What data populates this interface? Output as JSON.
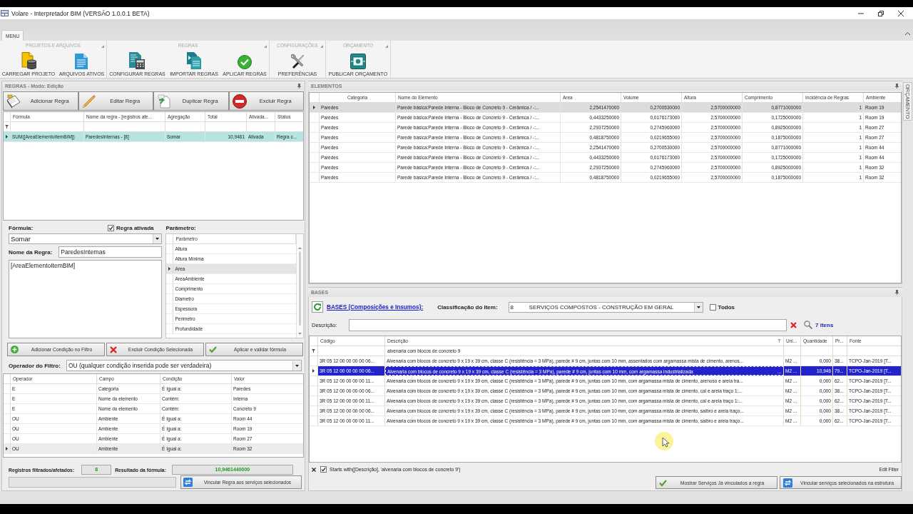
{
  "window": {
    "title": "Volare - Interpretador BIM (VERSÃO 1.0.0.1 BETA)"
  },
  "ribbon": {
    "tabs": [
      {
        "label": "MENU",
        "selected": true
      }
    ],
    "groups": [
      {
        "title": "PROJETOS E ARQUIVOS",
        "buttons": [
          {
            "label": "CARREGAR PROJETO",
            "kind": "database"
          },
          {
            "label": "ARQUIVOS ATIVOS",
            "kind": "document"
          }
        ]
      },
      {
        "title": "REGRAS",
        "buttons": [
          {
            "label": "CONFIGURAR REGRAS",
            "kind": "calculator"
          },
          {
            "label": "IMPORTAR REGRAS",
            "kind": "documents"
          },
          {
            "label": "APLICAR REGRAS",
            "kind": "check"
          }
        ]
      },
      {
        "title": "CONFIGURAÇÕES",
        "buttons": [
          {
            "label": "PREFERÊNCIAS",
            "kind": "tools"
          }
        ]
      },
      {
        "title": "ORÇAMENTO",
        "buttons": [
          {
            "label": "PUBLICAR ORÇAMENTO",
            "kind": "money"
          }
        ]
      }
    ]
  },
  "rules_panel": {
    "title": "REGRAS - Modo: Edição",
    "toolbar": [
      {
        "label": "Adicionar Regra",
        "kind": "notepad"
      },
      {
        "label": "Editar Regra",
        "kind": "pencil"
      },
      {
        "label": "Duplicar Regra",
        "kind": "duplicate"
      },
      {
        "label": "Excluir Regra",
        "kind": "delete"
      }
    ],
    "table": {
      "columns": [
        {
          "label": "Fórmula",
          "kind": "text"
        },
        {
          "label": "Nome da regra - [registros afe...",
          "kind": "text"
        },
        {
          "label": "Agregação",
          "kind": "text"
        },
        {
          "label": "Total",
          "kind": "number"
        },
        {
          "label": "Ativada...",
          "kind": "text"
        },
        {
          "label": "Status",
          "kind": "text"
        }
      ],
      "rows": [
        {
          "cells": [
            "SUM([AreaElementoItemBIM])",
            "ParedesInternas - [8]",
            "Somar",
            "10,9461",
            "Ativada",
            "Regra c..."
          ],
          "selected": true
        }
      ]
    }
  },
  "rule_editor": {
    "formula_label": "Fórmula:",
    "active_checkbox": {
      "label": "Regra ativada",
      "checked": true
    },
    "formula_select": {
      "value": "Somar"
    },
    "name_label": "Nome da Regra:",
    "name_field": {
      "value": "ParedesInternas"
    },
    "expression": {
      "value": "[AreaElementoItemBIM]"
    },
    "parameters": {
      "label": "Parâmetro:",
      "column": "Parâmetro",
      "items": [
        {
          "label": "Altura",
          "selected": false
        },
        {
          "label": "Altura Mínima",
          "selected": false
        },
        {
          "label": "Area",
          "selected": true
        },
        {
          "label": "AreaAmbiente",
          "selected": false
        },
        {
          "label": "Comprimento",
          "selected": false
        },
        {
          "label": "Diametro",
          "selected": false
        },
        {
          "label": "Espessura",
          "selected": false
        },
        {
          "label": "Perimetro",
          "selected": false
        },
        {
          "label": "Profundidade",
          "selected": false
        }
      ]
    }
  },
  "filter": {
    "buttons": [
      {
        "label": "Adicionar Condição no Filtro",
        "kind": "add"
      },
      {
        "label": "Excluir Condição Selecionada",
        "kind": "remove"
      },
      {
        "label": "Aplicar e validar fórmula",
        "kind": "check"
      }
    ],
    "operator_label": "Operador do Filtro:",
    "operator_select": {
      "value": "OU (qualquer condição inserida pode ser verdadeira)"
    },
    "table": {
      "columns": [
        "Operador",
        "Campo",
        "Condição",
        "Valor"
      ],
      "rows": [
        {
          "cells": [
            "E",
            "Categoria",
            "É Igual a:",
            "Paredes"
          ],
          "selected": false
        },
        {
          "cells": [
            "E",
            "Nome do elemento",
            "Contém:",
            "Interna"
          ],
          "selected": false
        },
        {
          "cells": [
            "E",
            "Nome do elemento",
            "Contém:",
            "Concreto 9"
          ],
          "selected": false
        },
        {
          "cells": [
            "OU",
            "Ambiente",
            "É Igual a:",
            "Room 44"
          ],
          "selected": false
        },
        {
          "cells": [
            "OU",
            "Ambiente",
            "É Igual a:",
            "Room 19"
          ],
          "selected": false
        },
        {
          "cells": [
            "OU",
            "Ambiente",
            "É Igual a:",
            "Room 27"
          ],
          "selected": false
        },
        {
          "cells": [
            "OU",
            "Ambiente",
            "É Igual a:",
            "Room 32"
          ],
          "selected": true
        }
      ]
    }
  },
  "summary": {
    "filtered_label": "Registros filtrados/afetados:",
    "filtered_value": "8",
    "result_label": "Resultado da fórmula:",
    "result_value": "10,9461440000",
    "button": {
      "label": "Vincular Regra aos serviços selecionados",
      "kind": "link"
    }
  },
  "elements_panel": {
    "title": "ELEMENTOS",
    "table": {
      "columns": [
        {
          "label": "Categoria",
          "kind": "text"
        },
        {
          "label": "Nome do Elemento",
          "kind": "text"
        },
        {
          "label": "Area",
          "kind": "number"
        },
        {
          "label": "Volume",
          "kind": "number"
        },
        {
          "label": "Altura",
          "kind": "number"
        },
        {
          "label": "Comprimento",
          "kind": "number"
        },
        {
          "label": "Incidência de Regras",
          "kind": "number"
        },
        {
          "label": "Ambiente",
          "kind": "text"
        }
      ],
      "rows": [
        {
          "cells": [
            "Paredes",
            "Parede básica:Parede Interna - Bloco de Concreto 9 - Cerâmica / -:...",
            "2,2541470000",
            "0,2700530000",
            "2,5700000000",
            "0,8771000000",
            "1",
            "Room 19"
          ],
          "selected": true
        },
        {
          "cells": [
            "Paredes",
            "Parede básica:Parede Interna - Bloco de Concreto 9 - Cerâmica / -:...",
            "0,4433250000",
            "0,0176173000",
            "2,5700000000",
            "0,1725000000",
            "1",
            "Room 19"
          ],
          "selected": false
        },
        {
          "cells": [
            "Paredes",
            "Parede básica:Parede Interna - Bloco de Concreto 9 - Cerâmica / -:...",
            "2,2937250000",
            "0,2745960000",
            "2,5700000000",
            "0,8925000000",
            "1",
            "Room 27"
          ],
          "selected": false
        },
        {
          "cells": [
            "Paredes",
            "Parede básica:Parede Interna - Bloco de Concreto 9 - Cerâmica / -:...",
            "0,4818750000",
            "0,0219655000",
            "2,5700000000",
            "0,1875000000",
            "1",
            "Room 27"
          ],
          "selected": false
        },
        {
          "cells": [
            "Paredes",
            "Parede básica:Parede Interna - Bloco de Concreto 9 - Cerâmica / -:...",
            "2,2541470000",
            "0,2700530000",
            "2,5700000000",
            "0,8771000000",
            "1",
            "Room 44"
          ],
          "selected": false
        },
        {
          "cells": [
            "Paredes",
            "Parede básica:Parede Interna - Bloco de Concreto 9 - Cerâmica / -:...",
            "0,4433250000",
            "0,0176173000",
            "2,5700000000",
            "0,1725000000",
            "1",
            "Room 44"
          ],
          "selected": false
        },
        {
          "cells": [
            "Paredes",
            "Parede básica:Parede Interna - Bloco de Concreto 9 - Cerâmica / -:...",
            "2,2937250000",
            "0,2745960000",
            "2,5700000000",
            "0,8925000000",
            "1",
            "Room 32"
          ],
          "selected": false
        },
        {
          "cells": [
            "Paredes",
            "Parede básica:Parede Interna - Bloco de Concreto 9 - Cerâmica / -:...",
            "0,4818750000",
            "0,0219655000",
            "2,5700000000",
            "0,1875000000",
            "1",
            "Room 32"
          ],
          "selected": false
        }
      ]
    }
  },
  "side_tab": {
    "label": "ORÇAMENTO"
  },
  "bases_panel": {
    "title": "BASES",
    "link": "BASES (Composições e Insumos):",
    "classification_label": "Classificação do Item:",
    "classification_select": {
      "code": "8",
      "value": "SERVIÇOS COMPOSTOS - CONSTRUÇÃO EM GERAL"
    },
    "all_checkbox": {
      "label": "Todos",
      "checked": false
    },
    "description_label": "Descrição:",
    "count": "7 itens",
    "table": {
      "columns": [
        {
          "label": "Código",
          "kind": "text"
        },
        {
          "label": "Descrição",
          "kind": "text",
          "filter": "alvenaria com blocos de concreto 9"
        },
        {
          "label": "Uni...",
          "kind": "text"
        },
        {
          "label": "Quantidade",
          "kind": "number"
        },
        {
          "label": "Pr...",
          "kind": "text"
        },
        {
          "label": "Fonte",
          "kind": "text"
        }
      ],
      "rows": [
        {
          "cells": [
            "3R 05 12 00 00 00 00 06...",
            "Alvenaria com blocos de concreto 9 x 19 x 39 cm, classe C (resistência = 3 MPa), parede # 9 cm, juntas com 10 mm, assentados com argamassa mista de cimento, arenos...",
            "M2 ...",
            "0,000",
            "38...",
            "TCPO-Jan-2019 [T..."
          ],
          "selected": false
        },
        {
          "cells": [
            "3R 05 12 00 00 00 00 06...",
            "Alvenaria com blocos de concreto 9 x 19 x 39 cm, classe C (resistência = 3 MPa), parede # 9 cm, juntas com 10 mm, com argamassa industrializada",
            "M2 ...",
            "10,946",
            "79...",
            "TCPO-Jan-2019 [T..."
          ],
          "selected": true,
          "edit_button": "..."
        },
        {
          "cells": [
            "3R 05 12 00 00 00 00 11...",
            "Alvenaria com blocos de concreto 9 x 19 x 39 cm, classe C (resistência = 3 MPa), parede # 9 cm, juntas com 10 mm, com argamassa mista de cimento, arenoso e areia tra...",
            "M2 ...",
            "0,000",
            "62...",
            "TCPO-Jan-2019 [T..."
          ],
          "selected": false
        },
        {
          "cells": [
            "3R 05 12 00 00 00 00 06...",
            "Alvenaria com blocos de concreto 9 x 19 x 39 cm, classe C (resistência = 3 MPa), parede # 9 cm, juntas com 10 mm, com argamassa mista de cimento, cal e areia traço 1:...",
            "M2 ...",
            "0,000",
            "38...",
            "TCPO-Jan-2019 [T..."
          ],
          "selected": false
        },
        {
          "cells": [
            "3R 05 12 00 00 00 00 11...",
            "Alvenaria com blocos de concreto 9 x 19 x 39 cm, classe C (resistência = 3 MPa), parede # 9 cm, juntas com 10 mm, com argamassa mista de cimento, cal e areia traço 1:...",
            "M2 ...",
            "0,000",
            "62...",
            "TCPO-Jan-2019 [T..."
          ],
          "selected": false
        },
        {
          "cells": [
            "3R 05 12 00 00 00 00 06...",
            "Alvenaria com blocos de concreto 9 x 19 x 39 cm, classe C (resistência = 3 MPa), parede # 9 cm, juntas com 10 mm, com argamassa mista de cimento, saibro e areia traço...",
            "M2 ...",
            "0,000",
            "38...",
            "TCPO-Jan-2019 [T..."
          ],
          "selected": false
        },
        {
          "cells": [
            "3R 05 12 00 00 00 00 11...",
            "Alvenaria com blocos de concreto 9 x 19 x 39 cm, classe C (resistência = 3 MPa), parede # 9 cm, juntas com 10 mm, com argamassa mista de cimento, saibro e areia traço...",
            "M2 ...",
            "0,000",
            "62...",
            "TCPO-Jan-2019 [T..."
          ],
          "selected": false
        }
      ]
    },
    "active_filter": {
      "checked": true,
      "text": "Starts with([Descrição], 'alvenaria com blocos de concreto 9')",
      "edit_link": "Edit Filter"
    },
    "buttons": [
      {
        "label": "Mostrar Serviços Já vinculados a regra",
        "kind": "check"
      },
      {
        "label": "Vincular serviços selecionados na estrutura",
        "kind": "link"
      }
    ]
  }
}
